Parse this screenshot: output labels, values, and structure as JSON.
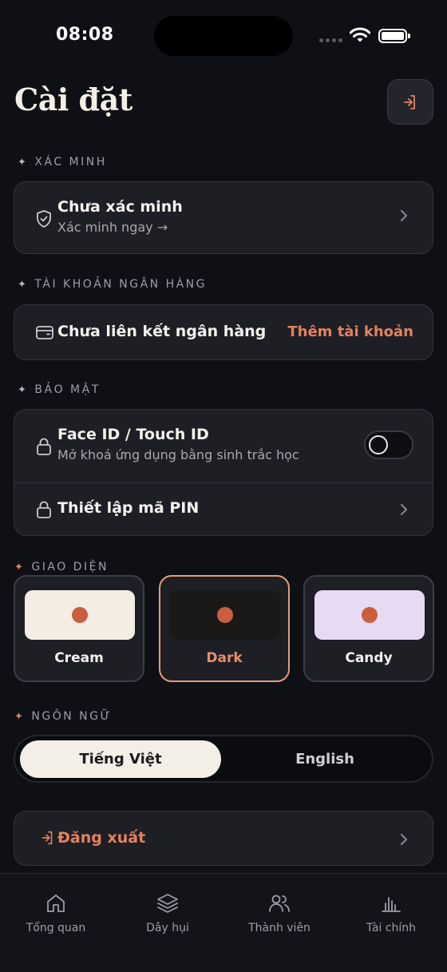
{
  "status_bar": {
    "time": "08:08"
  },
  "header": {
    "title": "Cài đặt",
    "logout_icon": "logout-icon"
  },
  "sections": {
    "verification": {
      "label": "XÁC MINH",
      "title": "Chưa xác minh",
      "subtitle": "Xác minh ngay →"
    },
    "bank": {
      "label": "TÀI KHOẢN NGÂN HÀNG",
      "title": "Chưa liên kết ngân hàng",
      "action": "Thêm tài khoản"
    },
    "security": {
      "label": "BẢO MẬT",
      "face_id_title": "Face ID / Touch ID",
      "face_id_subtitle": "Mở khoá ứng dụng bằng sinh trắc học",
      "face_id_enabled": false,
      "pin_title": "Thiết lập mã PIN"
    },
    "theme": {
      "label": "GIAO DIỆN",
      "options": [
        {
          "name": "Cream",
          "swatch": "#f3ede4",
          "selected": false
        },
        {
          "name": "Dark",
          "swatch": "#1a1918",
          "selected": true
        },
        {
          "name": "Candy",
          "swatch": "#e7daf3",
          "selected": false
        }
      ],
      "dot_color": "#c95f3f"
    },
    "language": {
      "label": "NGÔN NGỮ",
      "options": [
        "Tiếng Việt",
        "English"
      ],
      "selected": "Tiếng Việt"
    },
    "logout": {
      "label": "Đăng xuất"
    }
  },
  "tab_bar": {
    "items": [
      {
        "label": "Tổng quan",
        "icon": "home-icon"
      },
      {
        "label": "Dây hụi",
        "icon": "layers-icon"
      },
      {
        "label": "Thành viên",
        "icon": "users-icon"
      },
      {
        "label": "Tài chính",
        "icon": "bar-chart-icon"
      }
    ]
  },
  "colors": {
    "background": "#0f1016",
    "card": "#1e1f25",
    "accent": "#e3825d",
    "text": "#f2f0ec"
  }
}
